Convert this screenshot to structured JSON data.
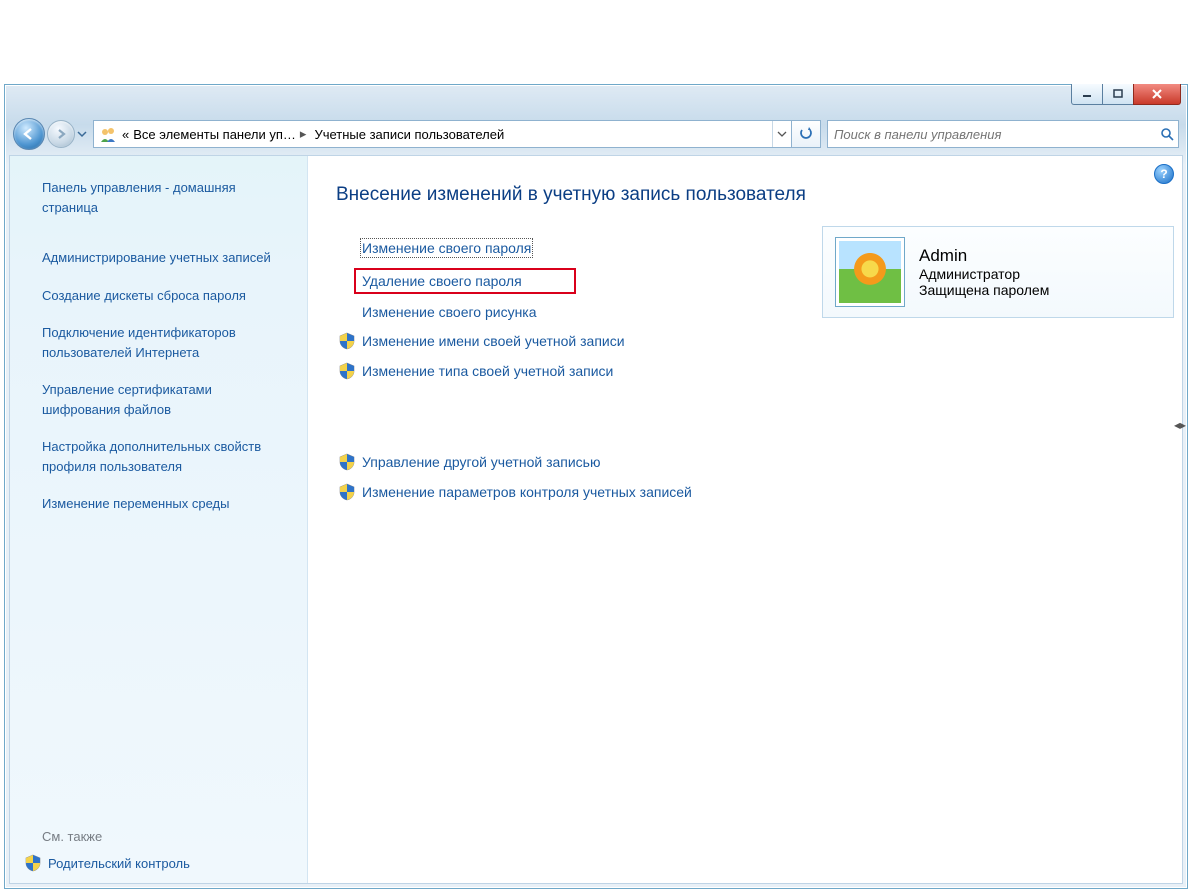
{
  "breadcrumb": {
    "segment1": "Все элементы панели уп…",
    "segment2": "Учетные записи пользователей"
  },
  "search": {
    "placeholder": "Поиск в панели управления"
  },
  "sidebar": {
    "home": "Панель управления - домашняя страница",
    "tasks": [
      "Администрирование учетных записей",
      "Создание дискеты сброса пароля",
      "Подключение идентификаторов пользователей Интернета",
      "Управление сертификатами шифрования файлов",
      "Настройка дополнительных свойств профиля пользователя",
      "Изменение переменных среды"
    ],
    "seealso": "См. также",
    "parental": "Родительский контроль"
  },
  "content": {
    "heading": "Внесение изменений в учетную запись пользователя",
    "tasks": {
      "change_password": "Изменение своего пароля",
      "delete_password": "Удаление своего пароля",
      "change_picture": "Изменение своего рисунка",
      "change_name": "Изменение имени своей учетной записи",
      "change_type": "Изменение типа своей учетной записи",
      "manage_other": "Управление другой учетной записью",
      "uac_settings": "Изменение параметров контроля учетных записей"
    },
    "user": {
      "name": "Admin",
      "role": "Администратор",
      "pwd": "Защищена паролем"
    }
  }
}
